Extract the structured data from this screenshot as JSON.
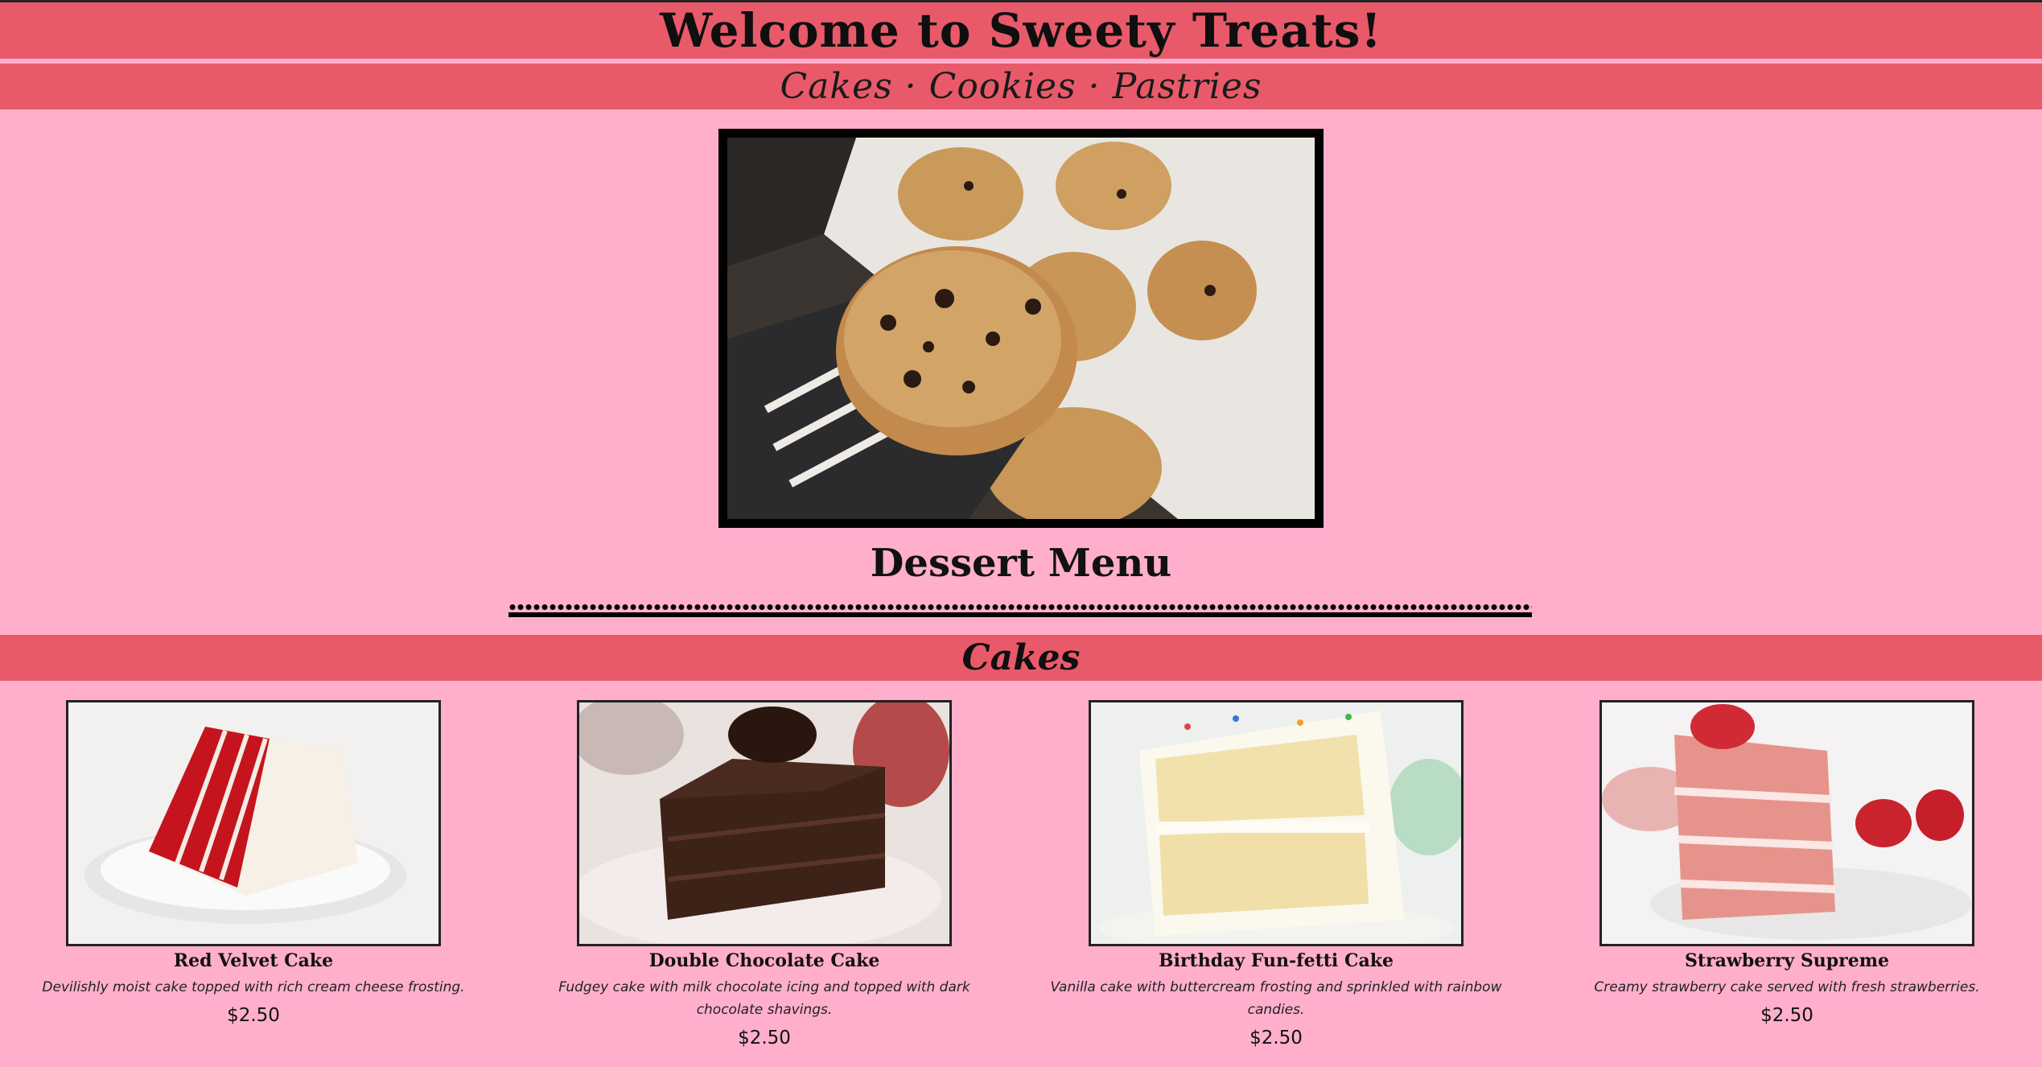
{
  "header": {
    "title": "Welcome to Sweety Treats!",
    "subtitle": "Cakes · Cookies · Pastries"
  },
  "hero": {
    "image": "chocolate-chip-cookies-photo"
  },
  "menu": {
    "heading": "Dessert Menu"
  },
  "sections": [
    {
      "title": "Cakes",
      "items": [
        {
          "name": "Red Velvet Cake",
          "description": "Devilishly moist cake topped with rich cream cheese frosting.",
          "price": "$2.50",
          "image": "red-velvet-cake-photo"
        },
        {
          "name": "Double Chocolate Cake",
          "description": "Fudgey cake with milk chocolate icing and topped with dark chocolate shavings.",
          "price": "$2.50",
          "image": "double-chocolate-cake-photo"
        },
        {
          "name": "Birthday Fun-fetti Cake",
          "description": "Vanilla cake with buttercream frosting and sprinkled with rainbow candies.",
          "price": "$2.50",
          "image": "birthday-funfetti-cake-photo"
        },
        {
          "name": "Strawberry Supreme",
          "description": "Creamy strawberry cake served with fresh strawberries.",
          "price": "$2.50",
          "image": "strawberry-supreme-cake-photo"
        }
      ]
    }
  ],
  "colors": {
    "page_background": "#ffafcc",
    "banner": "#e85a6a",
    "text": "#111111"
  }
}
